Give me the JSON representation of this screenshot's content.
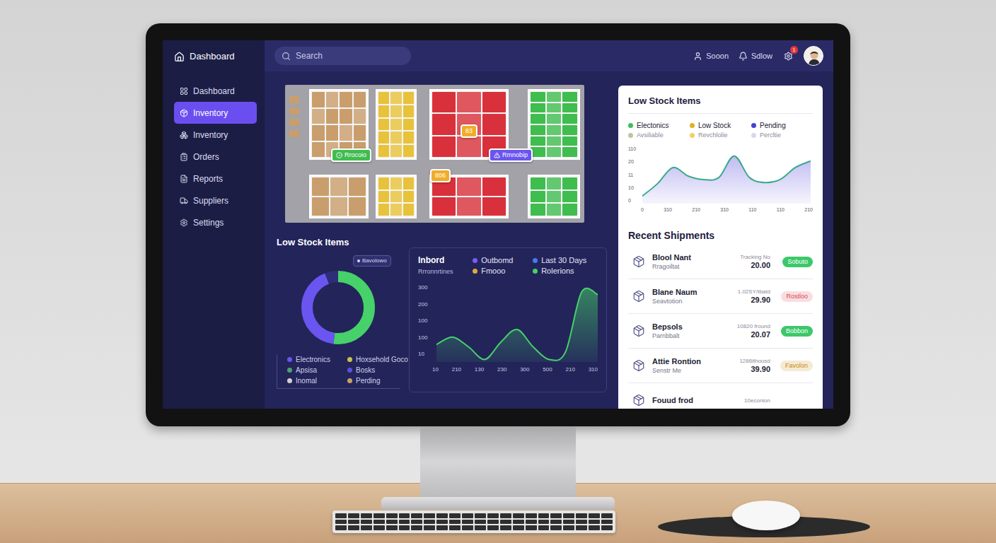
{
  "sidebar": {
    "logo": "Dashboard",
    "items": [
      {
        "label": "Dashboard",
        "selected": false
      },
      {
        "label": "Inventory",
        "selected": true
      },
      {
        "label": "Inventory",
        "selected": false
      },
      {
        "label": "Orders",
        "selected": false
      },
      {
        "label": "Reports",
        "selected": false
      },
      {
        "label": "Suppliers",
        "selected": false
      },
      {
        "label": "Settings",
        "selected": false
      }
    ]
  },
  "topbar": {
    "search": {
      "placeholder": "Search"
    },
    "user_label": "Sooon",
    "notifications_label": "Sdlow",
    "badge": "1"
  },
  "map": {
    "columns": [
      {
        "color": "#c99e6c"
      },
      {
        "color": "#e8c23a"
      },
      {
        "color": "#d9313b"
      },
      {
        "color": "#3fbd4f"
      }
    ],
    "pins": [
      {
        "label": "Rrocoio",
        "color": "#3fbd4f"
      },
      {
        "label": "Rmnobip",
        "color": "#6a55f0"
      },
      {
        "label": "83",
        "color": "#f0ad2a"
      },
      {
        "label": "806",
        "color": "#f0ad2a"
      }
    ]
  },
  "donut_panel": {
    "title": "Low Stock Items",
    "tooltip": "Bavolowo",
    "segments": [
      {
        "value": 52,
        "color": "#46d16a"
      },
      {
        "value": 42,
        "color": "#6a55f0"
      },
      {
        "value": 6,
        "color": "#2e2d78"
      }
    ],
    "legend": [
      {
        "label": "Electronics",
        "color": "#6a55f0"
      },
      {
        "label": "Hoxsehold Goco",
        "color": "#c8c24e"
      },
      {
        "label": "Apsisa",
        "color": "#4fa070"
      },
      {
        "label": "Bosks",
        "color": "#5a4fe0"
      },
      {
        "label": "Inomal",
        "color": "#d0d0d0"
      },
      {
        "label": "Perding",
        "color": "#c9a06a"
      }
    ]
  },
  "flow_chart": {
    "title": "Inbord",
    "subtitle": "Rrronnrtines",
    "legend": [
      {
        "label": "Outbomd",
        "color": "#7a5cf0"
      },
      {
        "label": "Last 30 Days",
        "color": "#4a78f0"
      },
      {
        "label": "Fmooo",
        "color": "#e0a93a"
      },
      {
        "label": "Rolerions",
        "color": "#46d16a"
      }
    ],
    "y_ticks": [
      "300",
      "200",
      "100",
      "100",
      "10"
    ],
    "x_ticks": [
      "10",
      "210",
      "130",
      "230",
      "300",
      "500",
      "210",
      "310"
    ],
    "series": [
      {
        "values": [
          70,
          100,
          60,
          10,
          80,
          130,
          60,
          10,
          40,
          280,
          270
        ],
        "color": "#46d16a"
      }
    ]
  },
  "stock_card": {
    "title": "Low Stock Items",
    "legend": [
      {
        "label": "Electonics",
        "color": "#3cbf5a"
      },
      {
        "label": "Low Stock",
        "color": "#e0b020"
      },
      {
        "label": "Pending",
        "color": "#4b3fd8"
      },
      {
        "label": "Avsiliable",
        "color": "#b8c9a0"
      },
      {
        "label": "Revchlolie",
        "color": "#f0d060"
      },
      {
        "label": "Percltie",
        "color": "#d8d8e8"
      }
    ],
    "y_ticks": [
      "110",
      "20",
      "11",
      "10",
      "0"
    ],
    "x_ticks": [
      "0",
      "310",
      "210",
      "310",
      "110",
      "110",
      "210"
    ],
    "series": [
      {
        "values": [
          15,
          40,
          72,
          55,
          48,
          52,
          95,
          52,
          42,
          48,
          72,
          85
        ],
        "color": "#3aa98c"
      }
    ]
  },
  "shipments": {
    "title": "Recent Shipments",
    "rows": [
      {
        "name": "Blool Nant",
        "sub": "Rragoiltat",
        "tracking": "Tracking No",
        "amount": "20.00",
        "status": "Sobuto",
        "kind": "solid",
        "color": "#3cc86a"
      },
      {
        "name": "Blane Naum",
        "sub": "Seavtotion",
        "tracking": "1.02SY/tbatd",
        "amount": "29.90",
        "status": "Rostloo",
        "kind": "soft",
        "color": "#e04858"
      },
      {
        "name": "Bepsols",
        "sub": "Parnbbalt",
        "tracking": "10820 fround",
        "amount": "20.07",
        "status": "Bobbon",
        "kind": "solid",
        "color": "#3cc86a"
      },
      {
        "name": "Attie Rontion",
        "sub": "Senstr Me",
        "tracking": "1286ithousd",
        "amount": "39.90",
        "status": "Favolon",
        "kind": "soft",
        "color": "#c98a10"
      },
      {
        "name": "Fouud frod",
        "tracking": "10econion"
      }
    ]
  }
}
